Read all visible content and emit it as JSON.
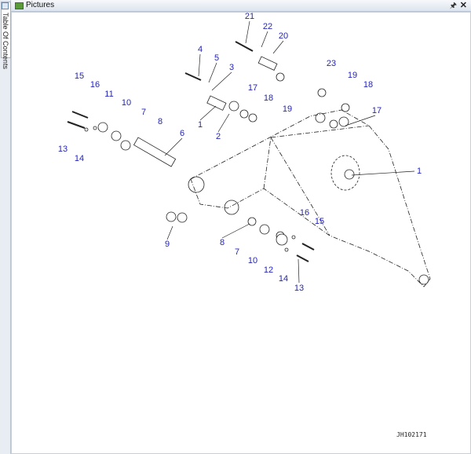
{
  "window": {
    "title": "Pictures",
    "pin_icon": "pin-icon",
    "close_icon": "close-icon"
  },
  "side_tab": {
    "label": "Table Of Contents"
  },
  "drawing_code": "JH102171",
  "callouts": [
    "21",
    "22",
    "20",
    "4",
    "5",
    "3",
    "23",
    "19",
    "18",
    "17",
    "18",
    "19",
    "17",
    "15",
    "16",
    "11",
    "10",
    "7",
    "8",
    "1",
    "2",
    "6",
    "13",
    "14",
    "1",
    "9",
    "16",
    "15",
    "8",
    "7",
    "10",
    "12",
    "14",
    "13"
  ]
}
